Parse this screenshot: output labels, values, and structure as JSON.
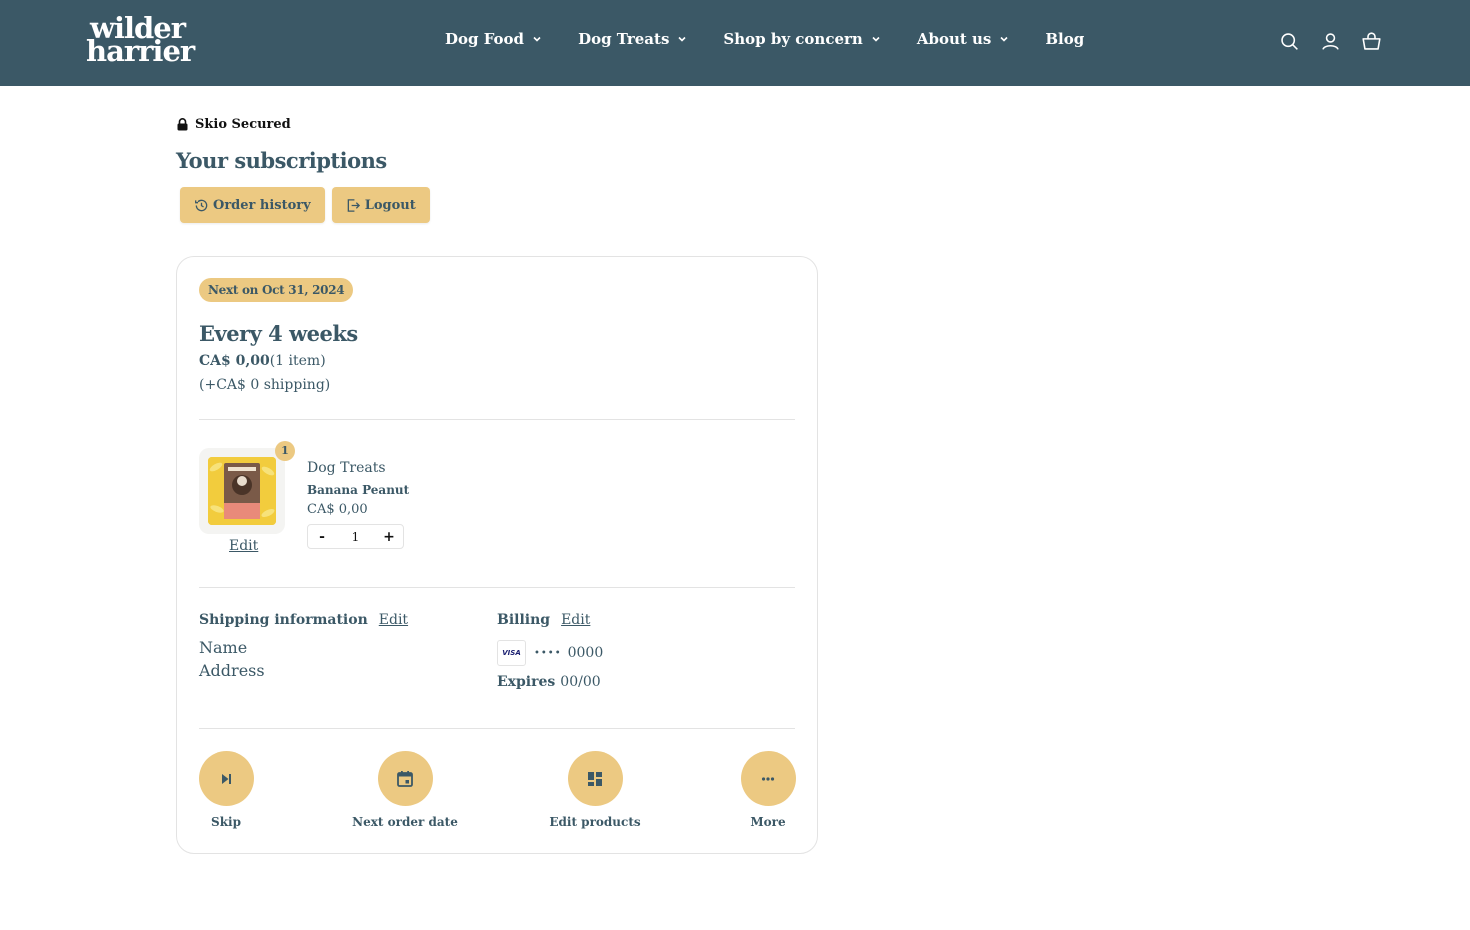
{
  "header": {
    "logo_line1": "wilder",
    "logo_line2": "harrier",
    "nav": [
      {
        "label": "Dog Food"
      },
      {
        "label": "Dog Treats"
      },
      {
        "label": "Shop by concern"
      },
      {
        "label": "About us"
      },
      {
        "label": "Blog"
      }
    ],
    "icons": [
      "search-icon",
      "account-icon",
      "cart-icon"
    ]
  },
  "secured_label": "Skio Secured",
  "page_title": "Your subscriptions",
  "buttons": {
    "order_history": "Order history",
    "logout": "Logout"
  },
  "subscription": {
    "next_badge": "Next on Oct 31, 2024",
    "frequency": "Every 4 weeks",
    "price": "CA$ 0,00",
    "items": "(1 item)",
    "shipping": "(+CA$ 0 shipping)",
    "product": {
      "quantity_badge": "1",
      "category": "Dog Treats",
      "variant": "Banana Peanut",
      "price": "CA$ 0,00",
      "edit_label": "Edit",
      "stepper": {
        "minus": "-",
        "value": "1",
        "plus": "+"
      }
    },
    "shipping_info": {
      "heading": "Shipping information",
      "edit_label": "Edit",
      "name": "Name",
      "address": "Address"
    },
    "billing": {
      "heading": "Billing",
      "edit_label": "Edit",
      "card_brand": "VISA",
      "masked": "••••",
      "last4": "0000",
      "expires_label": "Expires",
      "expires_value": "00/00"
    },
    "actions": [
      {
        "label": "Skip",
        "icon": "skip-next-icon"
      },
      {
        "label": "Next order date",
        "icon": "calendar-icon"
      },
      {
        "label": "Edit products",
        "icon": "dashboard-icon"
      },
      {
        "label": "More",
        "icon": "more-icon"
      }
    ]
  },
  "colors": {
    "header_bg": "#3b5866",
    "accent": "#ecc982",
    "text": "#3b5866"
  }
}
